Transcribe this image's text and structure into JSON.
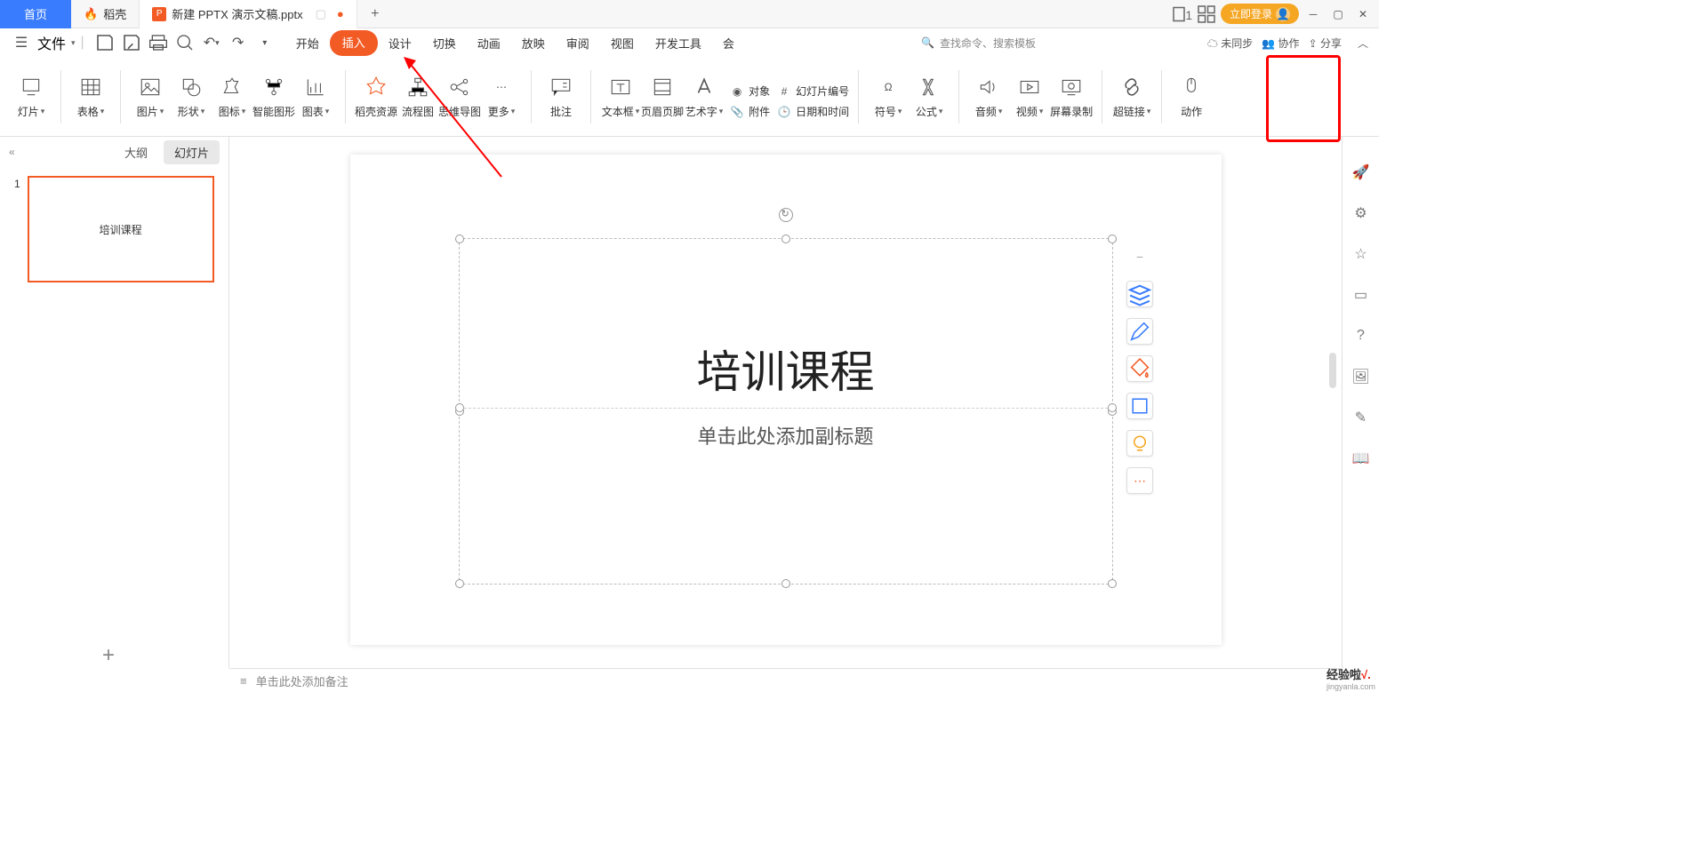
{
  "titlebar": {
    "home": "首页",
    "docker": "稻壳",
    "doc_name": "新建 PPTX 演示文稿.pptx",
    "login": "立即登录"
  },
  "menubar": {
    "file": "文件",
    "tabs": {
      "start": "开始",
      "insert": "插入",
      "design": "设计",
      "transition": "切换",
      "animation": "动画",
      "slideshow": "放映",
      "review": "审阅",
      "view": "视图",
      "devtools": "开发工具",
      "member": "会"
    },
    "search_placeholder": "查找命令、搜索模板",
    "not_synced": "未同步",
    "collab": "协作",
    "share": "分享"
  },
  "ribbon": {
    "slide": "灯片",
    "table": "表格",
    "picture": "图片",
    "shape": "形状",
    "icon": "图标",
    "smart": "智能图形",
    "chart": "图表",
    "res": "稻壳资源",
    "flow": "流程图",
    "mind": "思维导图",
    "more": "更多",
    "comment": "批注",
    "textbox": "文本框",
    "header": "页眉页脚",
    "wordart": "艺术字",
    "object": "对象",
    "slide_num": "幻灯片编号",
    "attach": "附件",
    "datetime": "日期和时间",
    "symbol": "符号",
    "formula": "公式",
    "audio": "音频",
    "video": "视频",
    "screenrec": "屏幕录制",
    "hyperlink": "超链接",
    "action": "动作"
  },
  "slidepanel": {
    "outline": "大纲",
    "slides": "幻灯片",
    "num1": "1",
    "thumb_title": "培训课程"
  },
  "slide": {
    "title": "培训课程",
    "subtitle": "单击此处添加副标题"
  },
  "statusbar": {
    "notes": "单击此处添加备注"
  },
  "watermark": {
    "main": "经验啦",
    "sub": "jingyanla.com"
  }
}
